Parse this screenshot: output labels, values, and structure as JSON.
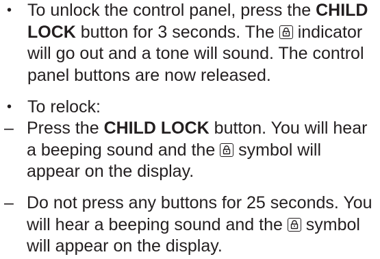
{
  "items": [
    {
      "marker": "•",
      "t1": "To unlock the control panel, press the ",
      "b1": "CHILD LOCK",
      "t2": " button for 3 seconds. The ",
      "icon": "lock-icon",
      "t3": " indicator will go out and a tone will sound. The control panel buttons are now released."
    },
    {
      "marker": "•",
      "t1": "To relock:"
    },
    {
      "marker": "–",
      "t1": "Press the ",
      "b1": "CHILD LOCK",
      "t2": " button. You will hear a beeping sound and the ",
      "icon": "lock-icon",
      "t3": " symbol will appear on the display."
    },
    {
      "marker": "–",
      "t1": "Do not press any buttons for 25 seconds. You will hear a beeping sound and the ",
      "icon": "lock-icon",
      "t2": " symbol will appear on the display."
    }
  ]
}
